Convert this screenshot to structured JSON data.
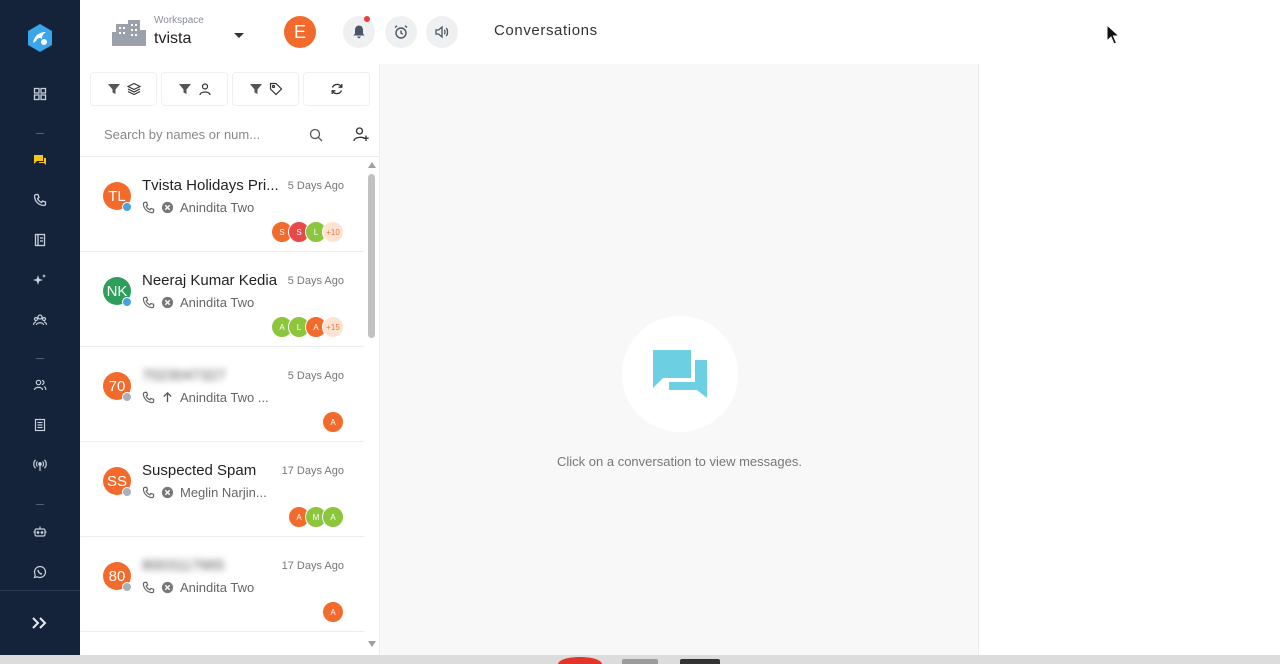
{
  "workspace": {
    "label": "Workspace",
    "name": "tvista"
  },
  "user": {
    "initial": "E"
  },
  "header": {
    "title": "Conversations"
  },
  "search": {
    "placeholder": "Search by names or num..."
  },
  "colors": {
    "rail": "#14233a",
    "accent_orange": "#f26b2c",
    "accent_green": "#2f9e5b",
    "empty_icon": "#6ccfe2"
  },
  "conversations": [
    {
      "initials": "TL",
      "name": "Tvista Holidays Pri...",
      "time": "5 Days Ago",
      "status_icon": "x-circle-icon",
      "assignee": "Anindita Two",
      "badge": "blue",
      "avatar_color": "orange",
      "chips": [
        {
          "t": "S",
          "c": "#f26b2c"
        },
        {
          "t": "S",
          "c": "#e84a4a"
        },
        {
          "t": "L",
          "c": "#8cc63f"
        },
        {
          "t": "+10",
          "c": "more"
        }
      ]
    },
    {
      "initials": "NK",
      "name": "Neeraj Kumar Kedia",
      "time": "5 Days Ago",
      "status_icon": "x-circle-icon",
      "assignee": "Anindita Two",
      "badge": "blue",
      "avatar_color": "green",
      "chips": [
        {
          "t": "A",
          "c": "#8cc63f"
        },
        {
          "t": "L",
          "c": "#8cc63f"
        },
        {
          "t": "A",
          "c": "#f26b2c"
        },
        {
          "t": "+15",
          "c": "more"
        }
      ]
    },
    {
      "initials": "70",
      "name": "7023047327",
      "time": "5 Days Ago",
      "status_icon": "arrow-up-icon",
      "assignee": "Anindita Two ...",
      "badge": "grey",
      "avatar_color": "orange",
      "blur": true,
      "chips": [
        {
          "t": "A",
          "c": "#f26b2c"
        }
      ]
    },
    {
      "initials": "SS",
      "name": "Suspected Spam",
      "time": "17 Days Ago",
      "status_icon": "x-circle-icon",
      "assignee": "Meglin Narjin...",
      "badge": "grey",
      "avatar_color": "orange",
      "chips": [
        {
          "t": "A",
          "c": "#f26b2c"
        },
        {
          "t": "M",
          "c": "#8cc63f"
        },
        {
          "t": "A",
          "c": "#8cc63f"
        }
      ]
    },
    {
      "initials": "80",
      "name": "8003117965",
      "time": "17 Days Ago",
      "status_icon": "x-circle-icon",
      "assignee": "Anindita Two",
      "badge": "grey",
      "avatar_color": "orange",
      "blur": true,
      "chips": [
        {
          "t": "A",
          "c": "#f26b2c"
        }
      ]
    }
  ],
  "empty_state": {
    "message": "Click on a conversation to view messages."
  }
}
